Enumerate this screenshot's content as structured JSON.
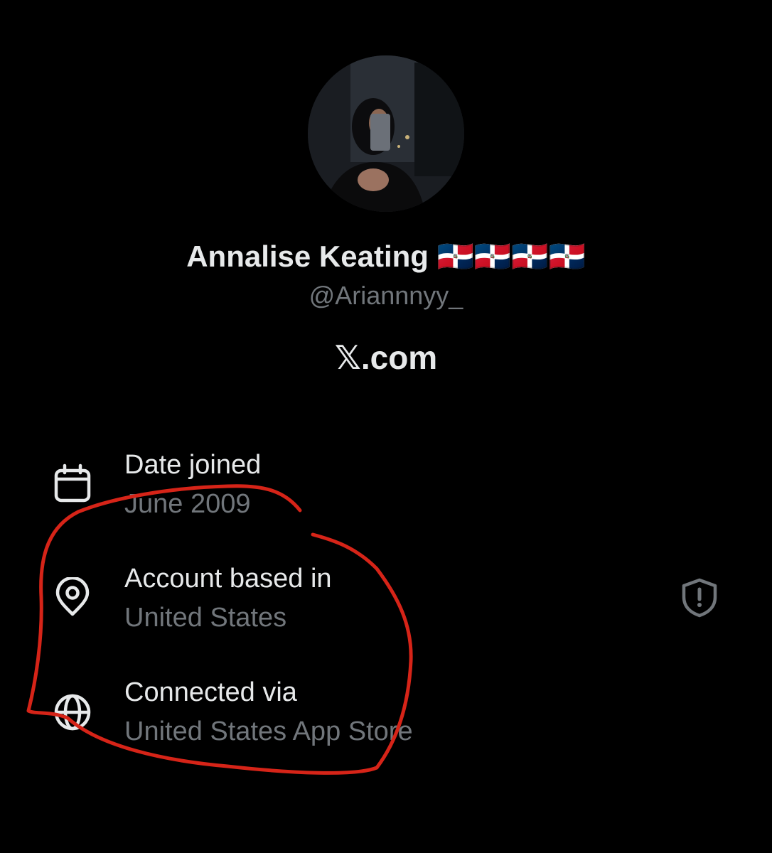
{
  "profile": {
    "display_name": "Annalise Keating 🇩🇴🇩🇴🇩🇴🇩🇴",
    "handle": "@Ariannnyy_",
    "source": "𝕏.com"
  },
  "about": {
    "date_joined": {
      "label": "Date joined",
      "value": "June 2009",
      "icon": "calendar-icon"
    },
    "account_based_in": {
      "label": "Account based in",
      "value": "United States",
      "icon": "location-pin-icon"
    },
    "connected_via": {
      "label": "Connected via",
      "value": "United States App Store",
      "icon": "globe-icon"
    },
    "notice_icon": "shield-alert-icon"
  },
  "colors": {
    "background": "#000000",
    "primary_text": "#e7e9ea",
    "secondary_text": "#71767b",
    "annotation": "#d62418"
  }
}
